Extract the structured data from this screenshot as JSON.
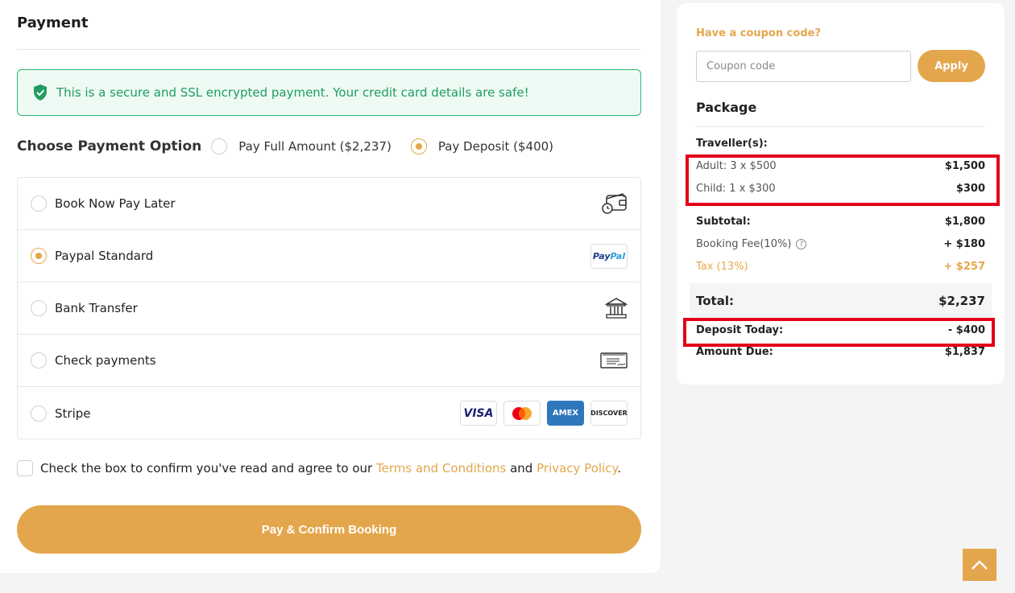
{
  "payment": {
    "title": "Payment",
    "secure_message": "This is a secure and SSL encrypted payment. Your credit card details are safe!",
    "choose_label": "Choose Payment Option",
    "options": [
      {
        "label": "Pay Full Amount ($2,237)",
        "selected": false
      },
      {
        "label": "Pay Deposit ($400)",
        "selected": true
      }
    ],
    "methods": [
      {
        "label": "Book Now Pay Later",
        "icon": "wallet-clock-icon",
        "selected": false
      },
      {
        "label": "Paypal Standard",
        "icon": "paypal-logo",
        "selected": true
      },
      {
        "label": "Bank Transfer",
        "icon": "bank-icon",
        "selected": false
      },
      {
        "label": "Check payments",
        "icon": "cheque-icon",
        "selected": false
      },
      {
        "label": "Stripe",
        "icon": "card-logos",
        "selected": false
      }
    ],
    "card_logos": [
      "VISA",
      "AMEX",
      "DISCOVER"
    ],
    "paypal_logo": {
      "pay": "Pay",
      "pal": "Pal"
    },
    "agree": {
      "prefix": "Check the box to confirm you've read and agree to our",
      "terms": "Terms and Conditions",
      "and": "and",
      "privacy": "Privacy Policy",
      "suffix": "."
    },
    "submit_label": "Pay & Confirm Booking"
  },
  "summary": {
    "coupon_title": "Have a coupon code?",
    "coupon_placeholder": "Coupon code",
    "apply_label": "Apply",
    "package_title": "Package",
    "travellers_label": "Traveller(s):",
    "adult": {
      "label": "Adult: 3 x $500",
      "value": "$1,500"
    },
    "child": {
      "label": "Child: 1 x $300",
      "value": "$300"
    },
    "subtotal": {
      "label": "Subtotal:",
      "value": "$1,800"
    },
    "booking_fee": {
      "label": "Booking Fee(10%)",
      "value": "+ $180"
    },
    "tax": {
      "label": "Tax (13%)",
      "value": "+ $257"
    },
    "total": {
      "label": "Total:",
      "value": "$2,237"
    },
    "deposit": {
      "label": "Deposit Today:",
      "value": "- $400"
    },
    "amount_due": {
      "label": "Amount Due:",
      "value": "$1,837"
    }
  },
  "colors": {
    "accent": "#e4a64c",
    "success": "#2bb673",
    "highlight": "#e2001a"
  }
}
